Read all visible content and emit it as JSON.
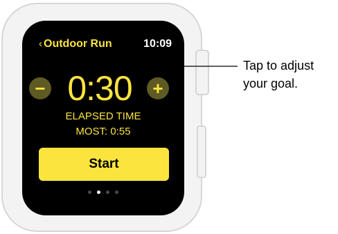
{
  "header": {
    "back_label": "Outdoor Run",
    "time": "10:09"
  },
  "goal": {
    "value": "0:30",
    "decrease_icon": "minus-icon",
    "increase_icon": "plus-icon"
  },
  "stats": {
    "label": "ELAPSED TIME",
    "best": "MOST: 0:55"
  },
  "start_button": {
    "label": "Start"
  },
  "pagination": {
    "count": 4,
    "active_index": 1
  },
  "callout": {
    "line1": "Tap to adjust",
    "line2": "your goal."
  },
  "colors": {
    "accent": "#fbe43e",
    "adjust_button_bg": "#5e5a24",
    "screen_bg": "#000000"
  }
}
